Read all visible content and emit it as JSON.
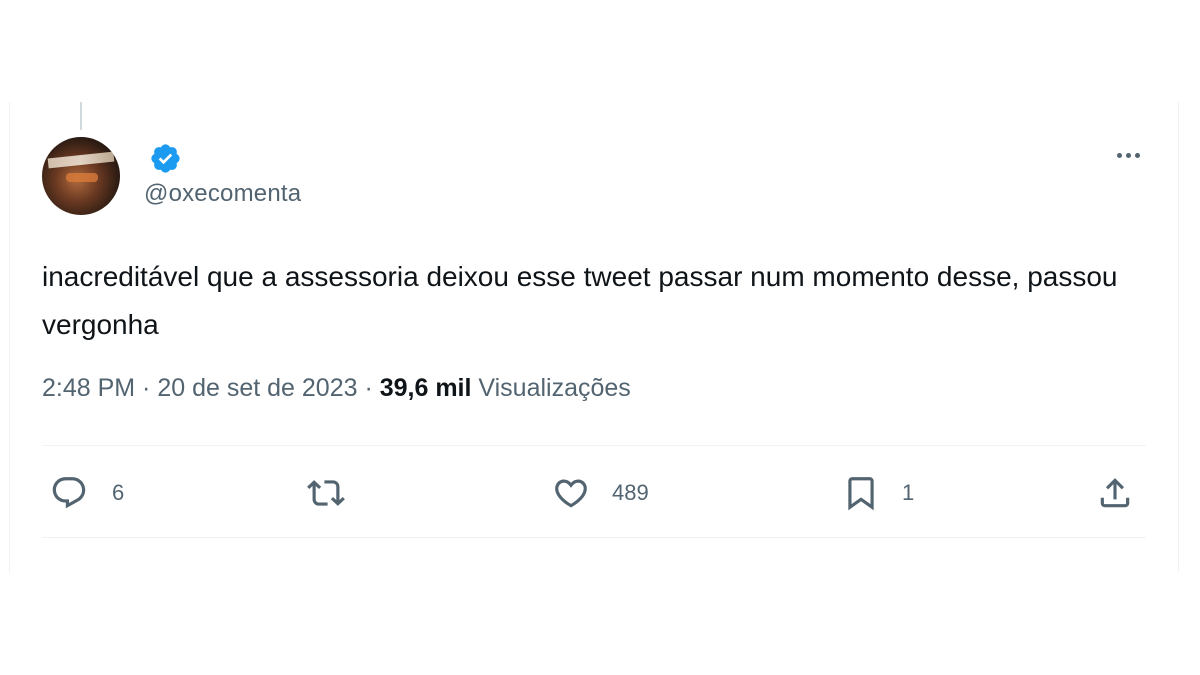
{
  "tweet": {
    "handle": "@oxecomenta",
    "text": "inacreditável que a assessoria deixou esse tweet passar num momento desse, passou vergonha",
    "time": "2:48 PM",
    "separator1": " · ",
    "date": "20 de set de 2023",
    "separator2": " · ",
    "views_count": "39,6 mil",
    "views_label": "Visualizações"
  },
  "actions": {
    "reply_count": "6",
    "retweet_count": "",
    "like_count": "489",
    "bookmark_count": "1"
  },
  "icons": {
    "verified": "verified-badge-icon",
    "more": "more-dots-icon",
    "reply": "reply-icon",
    "retweet": "retweet-icon",
    "like": "heart-icon",
    "bookmark": "bookmark-icon",
    "share": "share-icon"
  },
  "colors": {
    "verified_blue": "#1d9bf0",
    "secondary_text": "#536471",
    "primary_text": "#0f1419"
  }
}
